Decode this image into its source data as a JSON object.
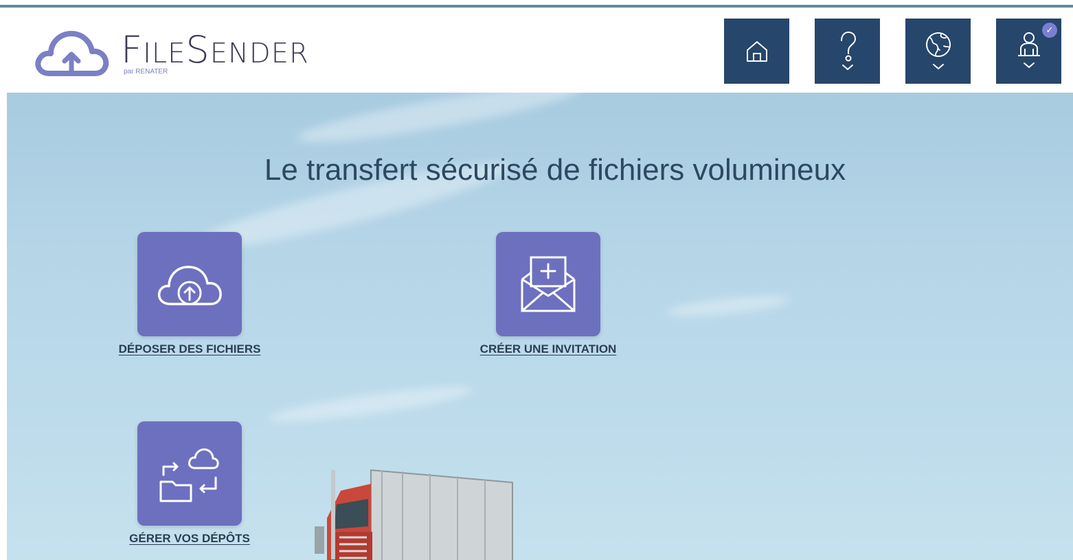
{
  "app": {
    "logo_text_first": "F",
    "logo_text_rest": "ILE",
    "logo_text_second": "S",
    "logo_text_end": "ENDER",
    "logo_subtitle": "par RENATER"
  },
  "header": {
    "buttons": [
      {
        "name": "home",
        "icon": "home-icon"
      },
      {
        "name": "help",
        "icon": "question-icon"
      },
      {
        "name": "language",
        "icon": "globe-icon"
      },
      {
        "name": "user",
        "icon": "user-icon",
        "badge": "✓"
      }
    ]
  },
  "hero": {
    "title": "Le transfert sécurisé de fichiers volumineux"
  },
  "actions": [
    {
      "label": "DÉPOSER DES FICHIERS",
      "icon": "cloud-upload-icon"
    },
    {
      "label": "CRÉER UNE INVITATION",
      "icon": "envelope-add-icon"
    },
    {
      "label": "GÉRER VOS DÉPÔTS",
      "icon": "manage-transfers-icon"
    }
  ],
  "colors": {
    "header_button": "#26466b",
    "action_tile": "#6d70bf",
    "badge": "#7b7fd3",
    "title": "#2c4862"
  }
}
